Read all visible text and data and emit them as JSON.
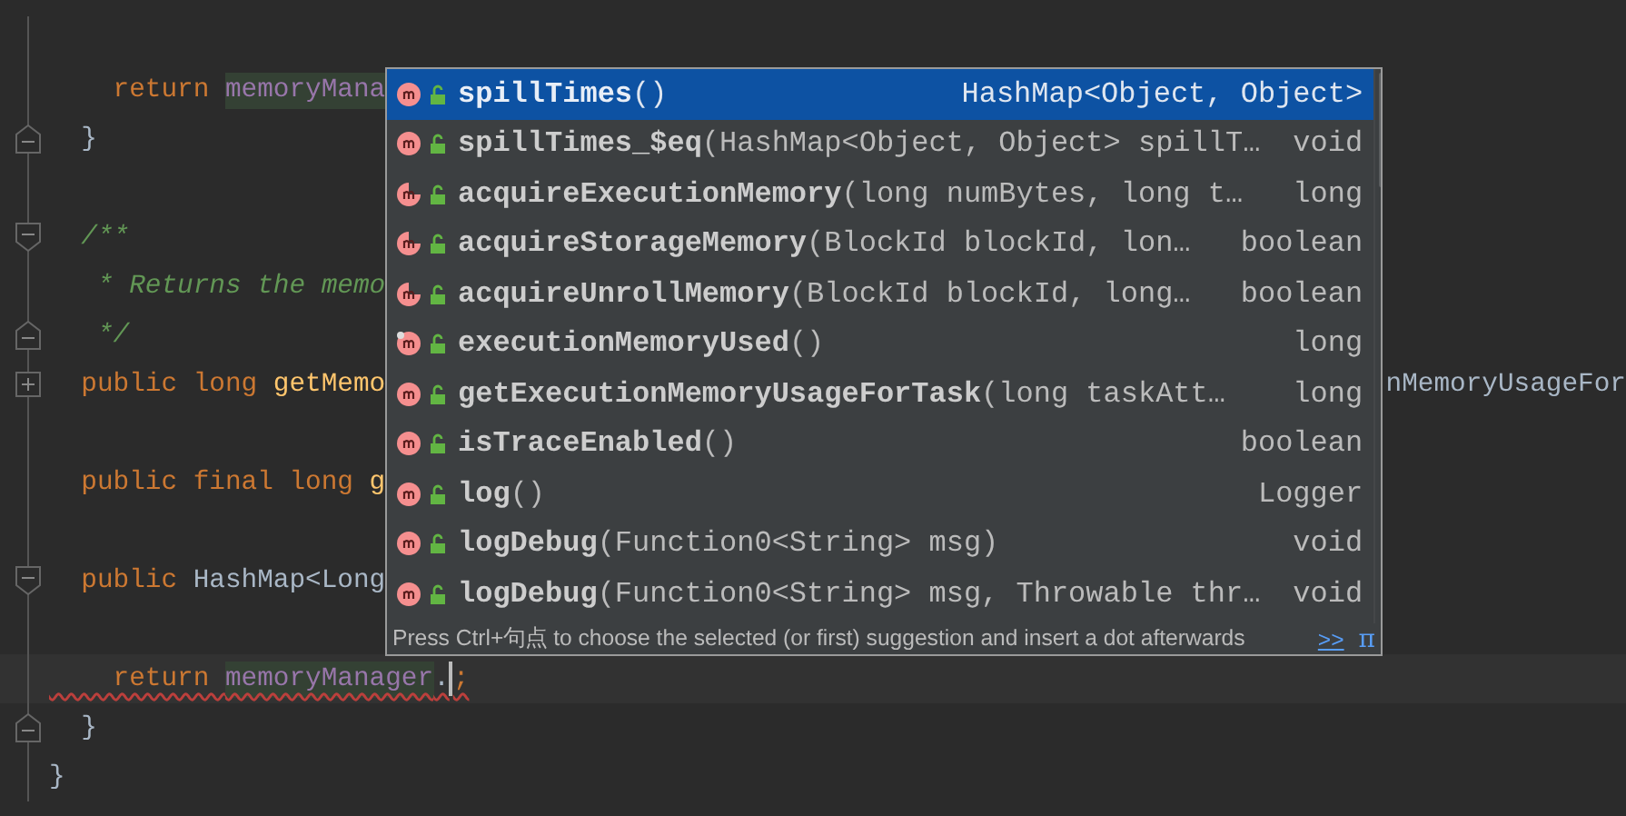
{
  "editor": {
    "lines": [
      {
        "kind": "plain"
      },
      {
        "kind": "plain",
        "tokens": [
          {
            "kind": "keyword",
            "text": "    return "
          },
          {
            "kind": "field",
            "text": "memoryMana",
            "highlight": true
          }
        ]
      },
      {
        "kind": "fold_end",
        "tokens": [
          {
            "kind": "plain",
            "text": "  }"
          }
        ]
      },
      {
        "kind": "plain"
      },
      {
        "kind": "fold_start",
        "tokens": [
          {
            "kind": "comment",
            "text": "  /**"
          }
        ]
      },
      {
        "kind": "plain",
        "tokens": [
          {
            "kind": "comment",
            "text": "   * Returns the memo"
          }
        ]
      },
      {
        "kind": "fold_end",
        "tokens": [
          {
            "kind": "comment",
            "text": "   */"
          }
        ]
      },
      {
        "kind": "folded",
        "tokens": [
          {
            "kind": "keyword",
            "text": "  public long "
          },
          {
            "kind": "method",
            "text": "getMemo"
          }
        ],
        "tail": "nMemoryUsageFor"
      },
      {
        "kind": "plain"
      },
      {
        "kind": "plain",
        "tokens": [
          {
            "kind": "keyword",
            "text": "  public final long "
          },
          {
            "kind": "method",
            "text": "g"
          }
        ]
      },
      {
        "kind": "plain"
      },
      {
        "kind": "fold_start",
        "tokens": [
          {
            "kind": "keyword",
            "text": "  public "
          },
          {
            "kind": "plain",
            "text": "HashMap<Long"
          }
        ]
      },
      {
        "kind": "plain"
      },
      {
        "kind": "plain",
        "current": true,
        "error": true,
        "tokens": [
          {
            "kind": "keyword",
            "text": "    return "
          },
          {
            "kind": "field",
            "text": "memoryManager",
            "highlight": true
          },
          {
            "kind": "plain",
            "text": ".",
            "caret": true
          },
          {
            "kind": "keyword",
            "text": ";"
          }
        ]
      },
      {
        "kind": "fold_end",
        "tokens": [
          {
            "kind": "plain",
            "text": "  }"
          }
        ]
      },
      {
        "kind": "plain",
        "tokens": [
          {
            "kind": "plain",
            "text": "}"
          }
        ]
      }
    ]
  },
  "completion": {
    "items": [
      {
        "kind": "method",
        "name": "spillTimes",
        "params": "()",
        "type": "HashMap<Object, Object>",
        "selected": true
      },
      {
        "kind": "method",
        "name": "spillTimes_$eq",
        "params": "(HashMap<Object, Object> spillT…",
        "type": "void",
        "selected": false
      },
      {
        "kind": "abstract",
        "name": "acquireExecutionMemory",
        "params": "(long numBytes, long t…",
        "type": "long",
        "selected": false
      },
      {
        "kind": "abstract",
        "name": "acquireStorageMemory",
        "params": "(BlockId blockId, lon…",
        "type": "boolean",
        "selected": false
      },
      {
        "kind": "abstract",
        "name": "acquireUnrollMemory",
        "params": "(BlockId blockId, long…",
        "type": "boolean",
        "selected": false
      },
      {
        "kind": "override",
        "name": "executionMemoryUsed",
        "params": "()",
        "type": "long",
        "selected": false
      },
      {
        "kind": "method",
        "name": "getExecutionMemoryUsageForTask",
        "params": "(long taskAtt…",
        "type": "long",
        "selected": false
      },
      {
        "kind": "method",
        "name": "isTraceEnabled",
        "params": "()",
        "type": "boolean",
        "selected": false
      },
      {
        "kind": "method",
        "name": "log",
        "params": "()",
        "type": "Logger",
        "selected": false
      },
      {
        "kind": "method",
        "name": "logDebug",
        "params": "(Function0<String> msg)",
        "type": "void",
        "selected": false
      },
      {
        "kind": "method",
        "name": "logDebug",
        "params": "(Function0<String> msg, Throwable thr…",
        "type": "void",
        "selected": false
      }
    ],
    "hint": "Press Ctrl+句点 to choose the selected (or first) suggestion and insert a dot afterwards",
    "hint_link": ">>",
    "hint_symbol": "π"
  }
}
